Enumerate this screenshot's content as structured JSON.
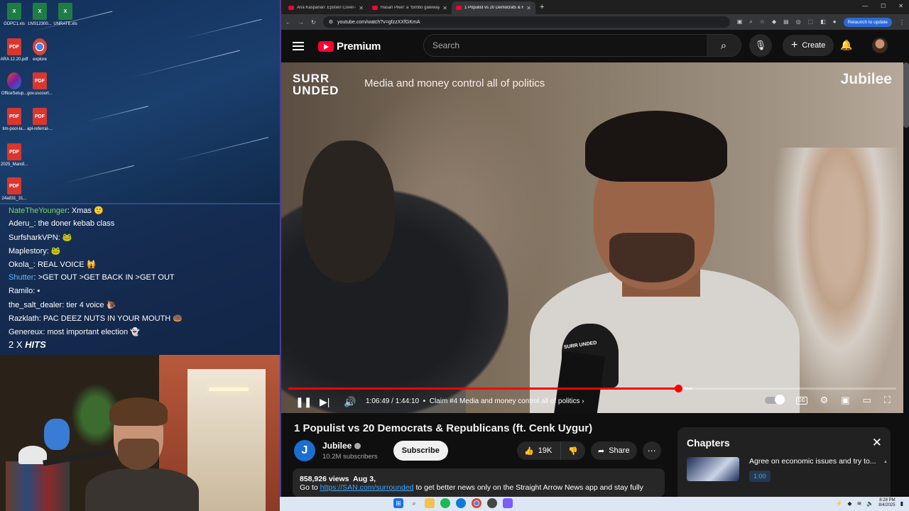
{
  "desktop": {
    "icons": [
      {
        "label": "GDPC1.xls",
        "type": "xls"
      },
      {
        "label": "LNS12300...",
        "type": "xls"
      },
      {
        "label": "UNRATE.xls",
        "type": "xls"
      },
      {
        "label": "ARA 12.20.pdf",
        "type": "pdf"
      },
      {
        "label": "explore",
        "type": "chrome"
      },
      {
        "label": "OfficeSetup...",
        "type": "office"
      },
      {
        "label": "gov.uscourt...",
        "type": "pdf"
      },
      {
        "label": "tim-pool-la...",
        "type": "pdf"
      },
      {
        "label": "apl-referral-...",
        "type": "pdf"
      },
      {
        "label": "2025_Mandl...",
        "type": "pdf"
      },
      {
        "label": "24a831_31...",
        "type": "pdf"
      }
    ],
    "pdf_glyph": "PDF",
    "xls_glyph": "X"
  },
  "chat": {
    "messages": [
      {
        "user": "NateTheYounger",
        "color": "#7bd96b",
        "text": "Xmas 🙂"
      },
      {
        "user": "Aderu_",
        "color": "#ffffff",
        "text": "the doner kebab class"
      },
      {
        "user": "SurfsharkVPN",
        "color": "#ffffff",
        "text": "🐸"
      },
      {
        "user": "Maplestory",
        "color": "#ffffff",
        "text": "🐸"
      },
      {
        "user": "Okola_",
        "color": "#ffffff",
        "text": "REAL VOICE 🙀"
      },
      {
        "user": "Shutter",
        "color": "#5cb8ff",
        "text": ">GET OUT >GET BACK IN >GET OUT"
      },
      {
        "user": "Ramilo",
        "color": "#ffffff",
        "text": "▪"
      },
      {
        "user": "the_salt_dealer",
        "color": "#ffffff",
        "text": "tier 4 voice 🐌"
      },
      {
        "user": "Razklath",
        "color": "#ffffff",
        "text": "PAC DEEZ NUTS IN YOUR MOUTH 🍩"
      },
      {
        "user": "Genereux",
        "color": "#ffffff",
        "text": "most important election 👻"
      }
    ],
    "hits_prefix": "2 X",
    "hits_word": "HITS"
  },
  "browser": {
    "tabs": [
      {
        "title": "Ana Kasparian: Epstein Cover-U...",
        "active": false
      },
      {
        "title": "Hasan Piker: a \"bimbo gateway\"...",
        "active": false
      },
      {
        "title": "1 Populist vs 20 Democrats & Re...",
        "active": true
      }
    ],
    "new_tab": "+",
    "url": "youtube.com/watch?v=gfzzXXfGKmA",
    "relaunch": "Relaunch to update"
  },
  "youtube": {
    "logo_text": "Premium",
    "search_placeholder": "Search",
    "create_label": "Create",
    "video": {
      "brand_line1": "SURR",
      "brand_line2": "UNDED",
      "tagline": "Media and money control all of politics",
      "jubilee": "Jubilee",
      "mic_brand": "SURR UNDED",
      "time_current": "1:06:49",
      "time_total": "1:44:10",
      "chapter": "Claim #4 Media and money control all of politics",
      "progress_fraction": 0.6416,
      "buffer_fraction": 0.665
    },
    "title": "1 Populist vs 20 Democrats & Republicans (ft. Cenk Uygur)",
    "channel": {
      "name": "Jubilee",
      "subscribers": "10.2M subscribers",
      "avatar_letter": "J"
    },
    "subscribe_label": "Subscribe",
    "likes": "19K",
    "share_label": "Share",
    "description": {
      "views": "858,926 views",
      "date": "Aug 3,",
      "lead": "Go to",
      "link": "https://SAN.com/surrounded",
      "rest": "to get better news only on the Straight Arrow News app and stay fully"
    },
    "chapters": {
      "heading": "Chapters",
      "item_title": "Agree on economic issues and try to...",
      "item_time": "1:00"
    }
  },
  "taskbar": {
    "time": "8:28 PM",
    "date": "8/4/2025"
  }
}
